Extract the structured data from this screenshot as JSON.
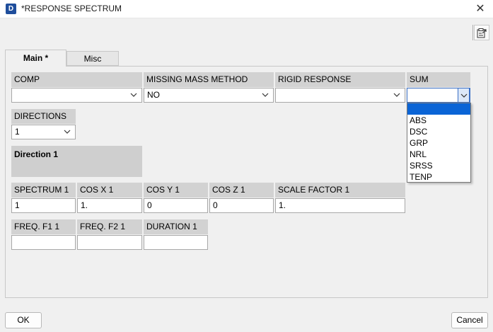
{
  "window": {
    "title": "*RESPONSE SPECTRUM",
    "icon_label": "D",
    "close_glyph": "✕"
  },
  "tabs": {
    "main_label": "Main *",
    "misc_label": "Misc"
  },
  "row1": {
    "comp_label": "COMP",
    "comp_value": "",
    "mmm_label": "MISSING MASS METHOD",
    "mmm_value": "NO",
    "rigid_label": "RIGID RESPONSE",
    "rigid_value": "",
    "sum_label": "SUM",
    "sum_value": ""
  },
  "directions": {
    "label": "DIRECTIONS",
    "value": "1"
  },
  "direction_section": {
    "title": "Direction 1"
  },
  "row3": {
    "spectrum_label": "SPECTRUM 1",
    "spectrum_value": "1",
    "cosx_label": "COS X 1",
    "cosx_value": "1.",
    "cosy_label": "COS Y 1",
    "cosy_value": "0",
    "cosz_label": "COS Z 1",
    "cosz_value": "0",
    "scale_label": "SCALE FACTOR 1",
    "scale_value": "1."
  },
  "row4": {
    "f1_label": "FREQ. F1 1",
    "f1_value": "",
    "f2_label": "FREQ. F2 1",
    "f2_value": "",
    "duration_label": "DURATION 1",
    "duration_value": ""
  },
  "sum_dropdown": {
    "options": [
      "",
      "ABS",
      "DSC",
      "GRP",
      "NRL",
      "SRSS",
      "TENP"
    ],
    "highlight_color": "#0a64d6"
  },
  "buttons": {
    "ok_label": "OK",
    "cancel_label": "Cancel"
  }
}
